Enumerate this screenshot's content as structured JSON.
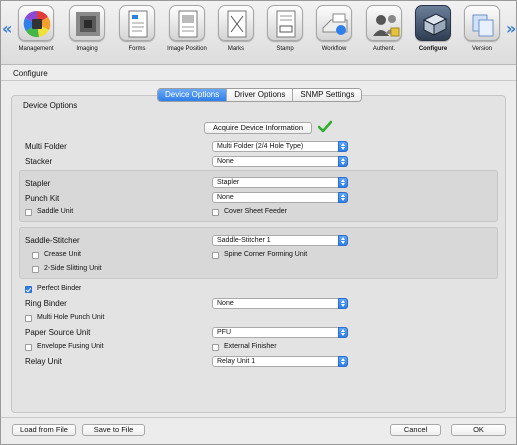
{
  "toolbar": {
    "items": [
      {
        "label": "Management",
        "icon": "management-icon"
      },
      {
        "label": "Imaging",
        "icon": "imaging-icon"
      },
      {
        "label": "Forms",
        "icon": "forms-icon"
      },
      {
        "label": "Image Position",
        "icon": "image-position-icon"
      },
      {
        "label": "Marks",
        "icon": "marks-icon"
      },
      {
        "label": "Stamp",
        "icon": "stamp-icon"
      },
      {
        "label": "Workflow",
        "icon": "workflow-icon"
      },
      {
        "label": "Authent.",
        "icon": "authentication-icon"
      },
      {
        "label": "Configure",
        "icon": "configure-icon"
      },
      {
        "label": "Version",
        "icon": "version-icon"
      }
    ],
    "selected": "Configure"
  },
  "section_title": "Configure",
  "tabs": [
    "Device Options",
    "Driver Options",
    "SNMP Settings"
  ],
  "active_tab": "Device Options",
  "group_title": "Device Options",
  "acquire_button": "Acquire Device Information",
  "fields": {
    "multi_folder": {
      "label": "Multi Folder",
      "value": "Multi Folder (2/4 Hole Type)"
    },
    "stacker": {
      "label": "Stacker",
      "value": "None"
    },
    "stapler": {
      "label": "Stapler",
      "value": "Stapler"
    },
    "punch_kit": {
      "label": "Punch Kit",
      "value": "None"
    },
    "saddle_stitcher": {
      "label": "Saddle-Stitcher",
      "value": "Saddle-Stitcher 1"
    },
    "ring_binder": {
      "label": "Ring Binder",
      "value": "None"
    },
    "paper_source_unit": {
      "label": "Paper Source Unit",
      "value": "PFU"
    },
    "relay_unit": {
      "label": "Relay Unit",
      "value": "Relay Unit 1"
    }
  },
  "checks": {
    "saddle_unit": {
      "label": "Saddle Unit",
      "checked": false
    },
    "cover_sheet_feeder": {
      "label": "Cover Sheet Feeder",
      "checked": false
    },
    "crease_unit": {
      "label": "Crease Unit",
      "checked": false
    },
    "spine_corner_forming_unit": {
      "label": "Spine Corner Forming Unit",
      "checked": false
    },
    "two_side_slitting_unit": {
      "label": "2-Side Slitting Unit",
      "checked": false
    },
    "perfect_binder": {
      "label": "Perfect Binder",
      "checked": true
    },
    "multi_hole_punch_unit": {
      "label": "Multi Hole Punch Unit",
      "checked": false
    },
    "envelope_fusing_unit": {
      "label": "Envelope Fusing Unit",
      "checked": false
    },
    "external_finisher": {
      "label": "External Finisher",
      "checked": false
    }
  },
  "footer": {
    "load": "Load from File",
    "save": "Save to File",
    "cancel": "Cancel",
    "ok": "OK"
  },
  "colors": {
    "accent": "#2f7fe9",
    "success": "#2fae2f"
  }
}
